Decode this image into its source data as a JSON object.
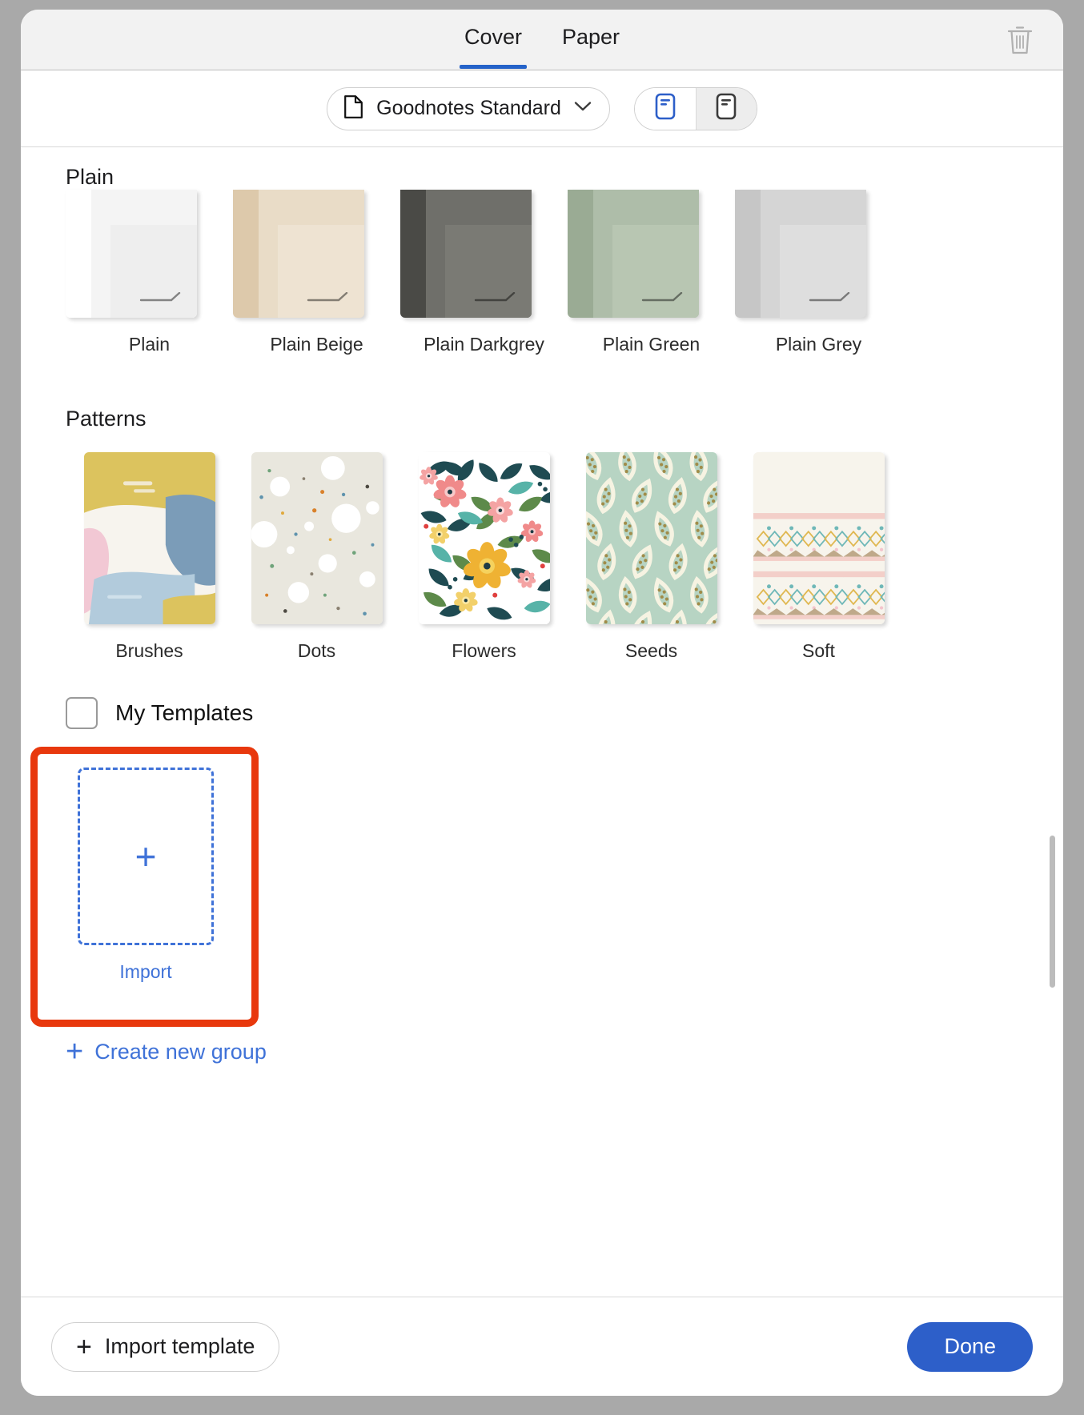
{
  "header": {
    "tabs": [
      {
        "label": "Cover",
        "active": true
      },
      {
        "label": "Paper",
        "active": false
      }
    ],
    "trash_icon": "trash-icon",
    "active_underline_color": "#2563c9"
  },
  "toolbar": {
    "template_picker": {
      "icon": "document-icon",
      "value": "Goodnotes Standard",
      "chevron": "chevron-down-icon"
    },
    "orientation": {
      "options": [
        {
          "name": "portrait",
          "icon": "portrait-page-icon",
          "selected": true
        },
        {
          "name": "landscape",
          "icon": "landscape-page-icon",
          "selected": false
        }
      ]
    }
  },
  "sections": [
    {
      "title": "Plain",
      "items": [
        {
          "label": "Plain",
          "base": "#f4f4f4",
          "spine": "#ffffff",
          "accent": "#ececec"
        },
        {
          "label": "Plain Beige",
          "base": "#e9dcc7",
          "spine": "#ddc9ab",
          "accent": "#efe5d5"
        },
        {
          "label": "Plain Darkgrey",
          "base": "#6f6f6a",
          "spine": "#4a4a46",
          "accent": "#7d7d78"
        },
        {
          "label": "Plain Green",
          "base": "#aebda9",
          "spine": "#9aab94",
          "accent": "#bbc9b6"
        },
        {
          "label": "Plain Grey",
          "base": "#d5d5d5",
          "spine": "#c6c6c6",
          "accent": "#e0e0e0"
        }
      ]
    },
    {
      "title": "Patterns",
      "items": [
        {
          "label": "Brushes",
          "pattern": "brushes"
        },
        {
          "label": "Dots",
          "pattern": "dots"
        },
        {
          "label": "Flowers",
          "pattern": "flowers"
        },
        {
          "label": "Seeds",
          "pattern": "seeds"
        },
        {
          "label": "Soft",
          "pattern": "soft"
        }
      ]
    }
  ],
  "my_templates": {
    "label": "My Templates",
    "checked": false
  },
  "import_area": {
    "plus_glyph": "+",
    "label": "Import",
    "highlight_color": "#e8380d",
    "dash_color": "#3f72d8"
  },
  "create_group": {
    "plus_glyph": "+",
    "label": "Create new group"
  },
  "footer": {
    "import_template": {
      "plus_glyph": "+",
      "label": "Import template"
    },
    "done": {
      "label": "Done",
      "color": "#2d5fc9"
    }
  }
}
